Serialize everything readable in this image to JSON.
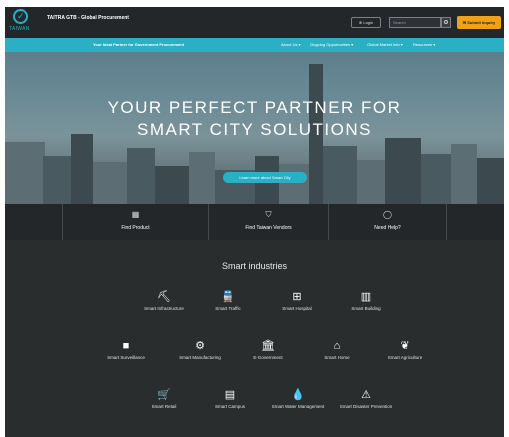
{
  "header": {
    "logo_text": "TAIWAN",
    "site_title": "TAITRA GTB - Global Procurement",
    "login_label": "Login",
    "search_placeholder": "Search",
    "quote_label": "Submit Inquiry"
  },
  "nav": {
    "tagline": "Your Ideal Partner for Government Procurement",
    "items": [
      "About Us",
      "Ongoing Opportunities",
      "Global Market Info",
      "Resources"
    ]
  },
  "hero": {
    "line1": "YOUR PERFECT PARTNER FOR",
    "line2": "SMART CITY SOLUTIONS",
    "button_label": "Learn more about Smart City"
  },
  "quick_links": [
    {
      "label": "Find Product",
      "icon": "product-grid-icon"
    },
    {
      "label": "Find Taiwan Vendors",
      "icon": "vendor-shield-icon"
    },
    {
      "label": "Need Help?",
      "icon": "chat-bubble-icon"
    }
  ],
  "industries": {
    "title": "Smart industries",
    "items": [
      {
        "label": "Smart Infrastructure",
        "icon": "crane-icon"
      },
      {
        "label": "Smart Traffic",
        "icon": "train-icon"
      },
      {
        "label": "Smart Hospital",
        "icon": "hospital-icon"
      },
      {
        "label": "Smart Building",
        "icon": "building-icon"
      },
      {
        "label": "Smart Surveillance",
        "icon": "camera-icon"
      },
      {
        "label": "Smart Manufacturing",
        "icon": "robot-arm-icon"
      },
      {
        "label": "E-Government",
        "icon": "government-icon"
      },
      {
        "label": "Smart Home",
        "icon": "home-icon"
      },
      {
        "label": "Smart Agriculture",
        "icon": "leaf-icon"
      },
      {
        "label": "Smart Retail",
        "icon": "cart-icon"
      },
      {
        "label": "Smart Campus",
        "icon": "campus-icon"
      },
      {
        "label": "Smart Water Management",
        "icon": "water-drop-icon"
      },
      {
        "label": "Smart Disaster Prevention",
        "icon": "warning-icon"
      }
    ]
  },
  "colors": {
    "accent": "#2ab0c4",
    "cta": "#f0a019",
    "background": "#2a2d2e"
  }
}
